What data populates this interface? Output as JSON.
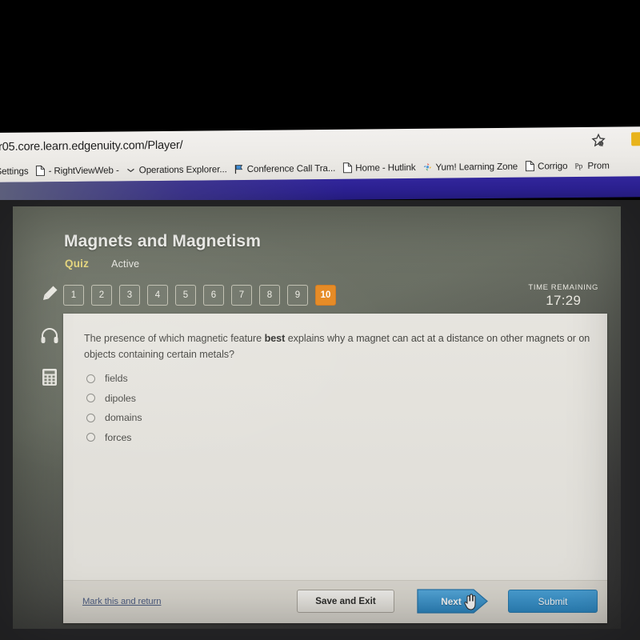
{
  "browser": {
    "url": "/r05.core.learn.edgenuity.com/Player/",
    "favorites_icon": "star-favorites-icon",
    "extension_icon": "extension-icon",
    "bookmarks": [
      {
        "label": "Settings",
        "icon": "none"
      },
      {
        "label": "- RightViewWeb -",
        "icon": "page-icon"
      },
      {
        "label": "Operations Explorer...",
        "icon": "chevron-icon"
      },
      {
        "label": "Conference Call Tra...",
        "icon": "flag-icon"
      },
      {
        "label": "Home - Hutlink",
        "icon": "page-icon"
      },
      {
        "label": "Yum! Learning Zone",
        "icon": "pinwheel-icon"
      },
      {
        "label": "Corrigo",
        "icon": "page-icon"
      },
      {
        "label": "Prom",
        "icon": "pp-icon"
      }
    ]
  },
  "header": {
    "title": "Magnets and Magnetism",
    "activity_type": "Quiz",
    "status": "Active",
    "quiz_color": "#e7d77a",
    "accent_color": "#e8881e"
  },
  "timer": {
    "label": "TIME REMAINING",
    "value": "17:29"
  },
  "pager": {
    "questions": [
      "1",
      "2",
      "3",
      "4",
      "5",
      "6",
      "7",
      "8",
      "9",
      "10"
    ],
    "current": "10"
  },
  "tools": [
    {
      "name": "highlighter-icon"
    },
    {
      "name": "headphones-icon"
    },
    {
      "name": "calculator-icon"
    }
  ],
  "question": {
    "text_before": "The presence of which magnetic feature ",
    "emphasis": "best",
    "text_after": " explains why a magnet can act at a distance on other magnets or on objects containing certain metals?",
    "choices": [
      {
        "label": "fields",
        "selected": false
      },
      {
        "label": "dipoles",
        "selected": false
      },
      {
        "label": "domains",
        "selected": false
      },
      {
        "label": "forces",
        "selected": false
      }
    ]
  },
  "footer": {
    "mark_link": "Mark this and return",
    "save_label": "Save and Exit",
    "next_label": "Next",
    "submit_label": "Submit",
    "next_color": "#2e8ac5",
    "submit_color": "#2e8ac5",
    "cursor": "hand-pointer-cursor"
  }
}
